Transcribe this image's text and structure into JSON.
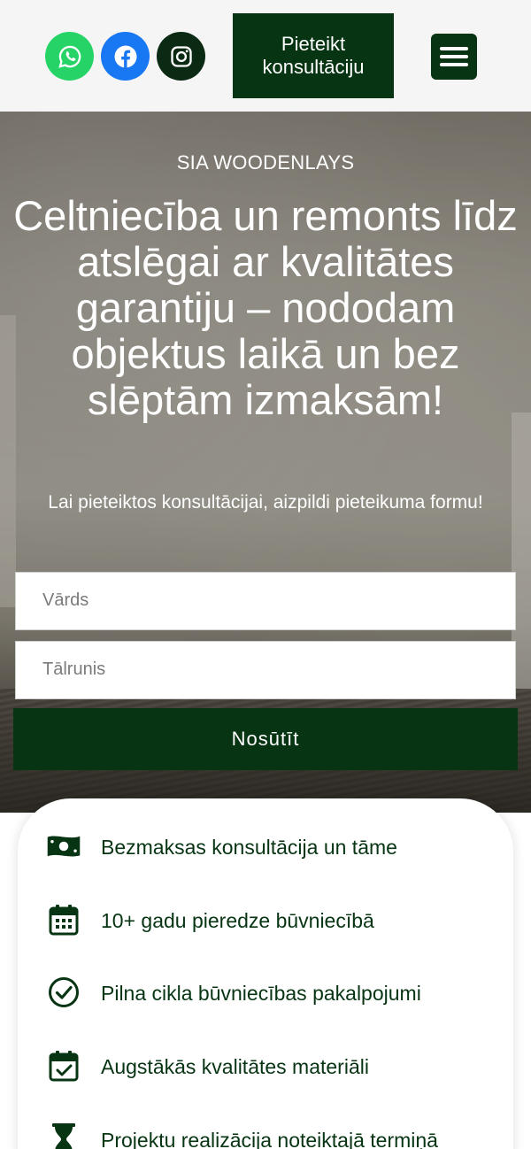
{
  "header": {
    "social": [
      {
        "name": "whatsapp",
        "icon": "whatsapp-icon",
        "color": "#25d366"
      },
      {
        "name": "facebook",
        "icon": "facebook-icon",
        "color": "#1877f2"
      },
      {
        "name": "instagram",
        "icon": "instagram-icon",
        "color": "#0b2a14"
      }
    ],
    "cta_label": "Pieteikt konsultāciju",
    "menu_icon": "hamburger-menu-icon"
  },
  "hero": {
    "company": "SIA WOODENLAYS",
    "title": "Celtniecība un remonts līdz atslēgai ar kvalitātes garantiju – nododam objektus laikā un bez slēptām izmaksām!",
    "subtitle": "Lai pieteiktos konsultācijai, aizpildi pieteikuma formu!",
    "form": {
      "name_placeholder": "Vārds",
      "phone_placeholder": "Tālrunis",
      "submit_label": "Nosūtīt"
    }
  },
  "benefits": [
    {
      "icon": "money-bill-icon",
      "label": "Bezmaksas konsultācija un tāme"
    },
    {
      "icon": "calendar-icon",
      "label": "10+ gadu pieredze būvniecībā"
    },
    {
      "icon": "check-circle-icon",
      "label": "Pilna cikla būvniecības pakalpojumi"
    },
    {
      "icon": "calendar-check-icon",
      "label": "Augstākās kvalitātes materiāli"
    },
    {
      "icon": "hourglass-icon",
      "label": "Projektu realizācija noteiktajā termiņā"
    }
  ],
  "colors": {
    "brand_green": "#073413",
    "header_bg": "#f5f5f5"
  }
}
